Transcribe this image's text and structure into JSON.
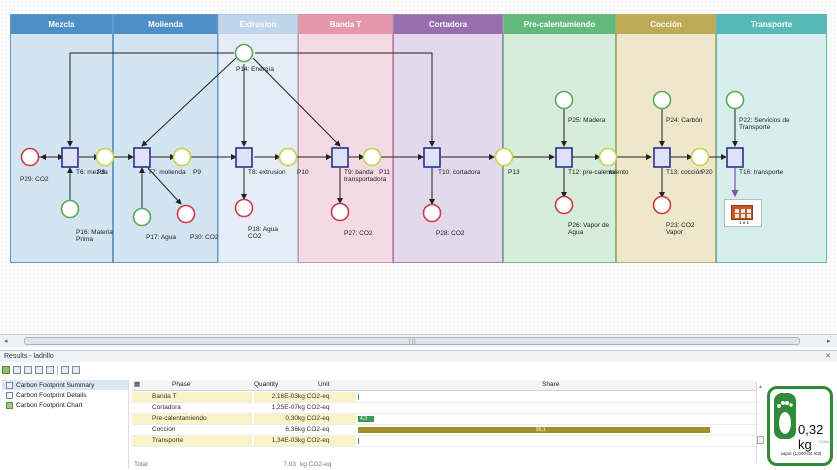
{
  "phases": [
    {
      "name": "Mezcla",
      "header_color": "#3f86c2",
      "fill": "#d0e4f1",
      "border": "#5a93c4"
    },
    {
      "name": "Molienda",
      "header_color": "#3f86c2",
      "fill": "#d0e4f1",
      "border": "#5a93c4"
    },
    {
      "name": "Extrusion",
      "header_color": "#bad3ec",
      "fill": "#e3ecf6",
      "border": "#a9c2dc"
    },
    {
      "name": "Banda T",
      "header_color": "#e28fa7",
      "fill": "#f4d8e1",
      "border": "#d88aa0"
    },
    {
      "name": "Cortadora",
      "header_color": "#8f64a8",
      "fill": "#e2d5ec",
      "border": "#9b7ab2"
    },
    {
      "name": "Pre-calentamiendo",
      "header_color": "#58b573",
      "fill": "#d4ecd9",
      "border": "#6bb57f"
    },
    {
      "name": "Cocción",
      "header_color": "#b9a548",
      "fill": "#ede6c8",
      "border": "#b6a557"
    },
    {
      "name": "Transporte",
      "header_color": "#4ab5b1",
      "fill": "#d3eeec",
      "border": "#58b2ae"
    }
  ],
  "net": {
    "transitions": [
      "T6: mezcla",
      "T7: molienda",
      "T8: extrusion",
      "T9: banda transportadora",
      "T10: cortadora",
      "T12: pre-calentamiento",
      "T13: cocción",
      "T16: transporte"
    ],
    "places": [
      "P8",
      "P9",
      "P10",
      "P11",
      "P13",
      "P14: Energía",
      "P16: Materia Prima",
      "P17: Agua",
      "P18: Agua CO2",
      "P20",
      "P22: Servicios de Transporte",
      "P23: CO2 Vapor",
      "P24: Carbón",
      "P25: Madera",
      "P26: Vapor de Agua",
      "P27: CO2",
      "P28: CO2",
      "P29: CO2",
      "P30: CO2"
    ],
    "labels": {
      "p14": "P14: Energía",
      "p29": "P29: CO2",
      "t6": "T6: mezcla",
      "p8": "P8",
      "p16": [
        "P16: Materia",
        "Prima"
      ],
      "t7": "T7: molienda",
      "p9": "P9",
      "p17": "P17: Agua",
      "p30": "P30: CO2",
      "t8": "T8: extrusion",
      "p10": "P10",
      "p18": [
        "P18: Agua",
        "CO2"
      ],
      "t9": [
        "T9: banda",
        "transportadora"
      ],
      "p11": "P11",
      "p27": "P27: CO2",
      "t10": "T10: cortadora",
      "p28": "P28: CO2",
      "p13": "P13",
      "p25": "P25: Madera",
      "t12": "T12: pre-calenta",
      "p_overlap": "miento",
      "p26": [
        "P26: Vapor de",
        "Agua"
      ],
      "p24": "P24: Carbón",
      "t13": "T13: cocción",
      "p20": "P20",
      "p23": [
        "P23: CO2",
        "Vapor"
      ],
      "p22": [
        "P22: Servicios de",
        "Transporte"
      ],
      "t16": "T16: transporte",
      "brick": "1 a 1"
    },
    "colors": {
      "transition_fill": "#dfe2f7",
      "transition_stroke": "#2a2f8e",
      "place_yellow": "#c8d24a",
      "place_green": "#5aa85a",
      "place_red": "#cc3a45",
      "arc": "#222222"
    }
  },
  "scrollbar": {
    "grip": "|||",
    "left_arrow": "◂",
    "right_arrow": "▸"
  },
  "results": {
    "title": "Results - ladrillo",
    "close": "✕",
    "tree": [
      {
        "label": "Carbon Footprint Summary",
        "icon": "summary-icon"
      },
      {
        "label": "Carbon Footprint Details",
        "icon": "details-icon"
      },
      {
        "label": "Carbon Footprint Chart",
        "icon": "chart-icon"
      }
    ],
    "table": {
      "headers": {
        "phase": "Phase",
        "quantity": "Quantity",
        "unit": "Unit",
        "share": "Share"
      },
      "rows": [
        {
          "phase": "Banda T",
          "quantity": "2,16E-03",
          "unit": "kg CO2-eq",
          "share_pct": 0.07,
          "share_label": ""
        },
        {
          "phase": "Cortadora",
          "quantity": "1,25E-07",
          "unit": "kg CO2-eq",
          "share_pct": 0,
          "share_label": ""
        },
        {
          "phase": "Pre-calentamiendo",
          "quantity": "0,30",
          "unit": "kg CO2-eq",
          "share_pct": 4.3,
          "share_label": "4,3"
        },
        {
          "phase": "Cocción",
          "quantity": "6,36",
          "unit": "kg CO2-eq",
          "share_pct": 95.1,
          "share_label": "95,1"
        },
        {
          "phase": "Transporte",
          "quantity": "1,34E-03",
          "unit": "kg CO2-eq",
          "share_pct": 0.02,
          "share_label": ""
        }
      ],
      "total_label": "Total",
      "total_quantity": "7,03",
      "total_unit": "kg CO2-eq"
    },
    "badge": {
      "value": "0,32 kg",
      "sub": "CO2eq",
      "caption": "vapor (1,000-04 m3)",
      "color": "#2f8a3a"
    }
  }
}
